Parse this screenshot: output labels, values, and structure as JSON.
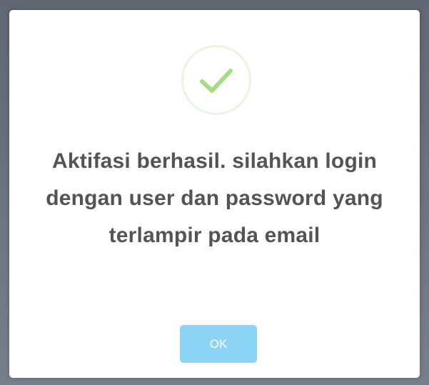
{
  "dialog": {
    "icon": "checkmark-success-icon",
    "message": "Aktifasi berhasil. silahkan login dengan user dan password yang terlampir pada email",
    "ok_label": "OK"
  },
  "colors": {
    "checkmark": "#a5dc86",
    "icon_ring": "#e8f5e0",
    "button": "#8cd4f5",
    "text": "#545454",
    "overlay": "#6b7480"
  }
}
